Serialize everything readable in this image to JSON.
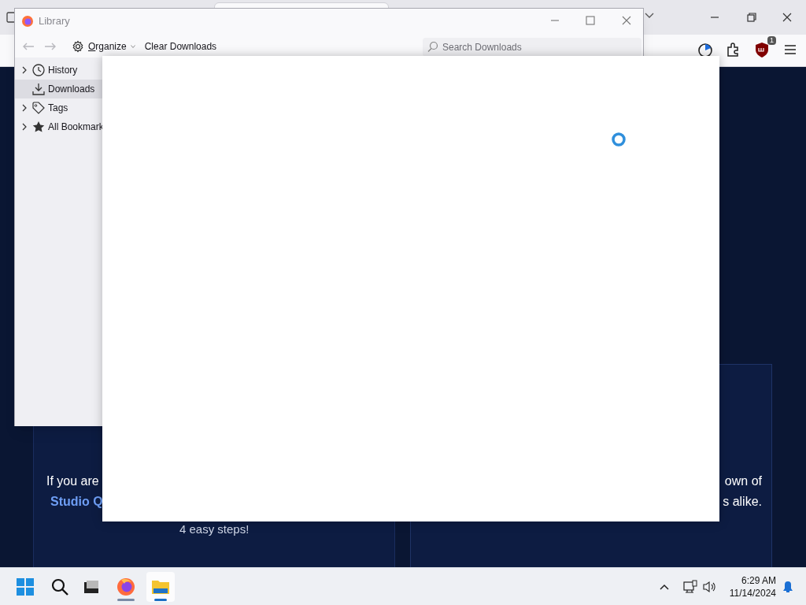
{
  "browser": {
    "toolbar_icons": [
      {
        "kind": "progress"
      },
      {
        "kind": "extensions"
      },
      {
        "kind": "shield",
        "badge": "1"
      },
      {
        "kind": "menu"
      }
    ]
  },
  "page": {
    "left_card": {
      "line_1": "If you are",
      "link": "Studio Q",
      "line_3": "4 easy steps!"
    },
    "right_card": {
      "line_1": "own of",
      "line_2": "s alike."
    }
  },
  "library": {
    "title": "Library",
    "back": {
      "disabled": true
    },
    "forward": {
      "disabled": true
    },
    "organize": "Organize",
    "clear_button": "Clear Downloads",
    "search": {
      "placeholder": "Search Downloads"
    },
    "sidebar": [
      {
        "kind": "history",
        "label": "History",
        "expandable": true,
        "selected": false
      },
      {
        "kind": "downloads",
        "label": "Downloads",
        "expandable": false,
        "selected": true
      },
      {
        "kind": "tags",
        "label": "Tags",
        "expandable": true,
        "selected": false
      },
      {
        "kind": "bookmarks",
        "label": "All Bookmark",
        "expandable": true,
        "selected": false
      }
    ]
  },
  "dialog": {
    "loading": true
  },
  "taskbar": {
    "apps": [
      {
        "kind": "window",
        "running": false,
        "selected": false
      },
      {
        "kind": "firefox",
        "running": true,
        "selected": false
      },
      {
        "kind": "explorer",
        "running": true,
        "selected": true
      }
    ],
    "time": "6:29 AM",
    "date": "11/14/2024"
  }
}
